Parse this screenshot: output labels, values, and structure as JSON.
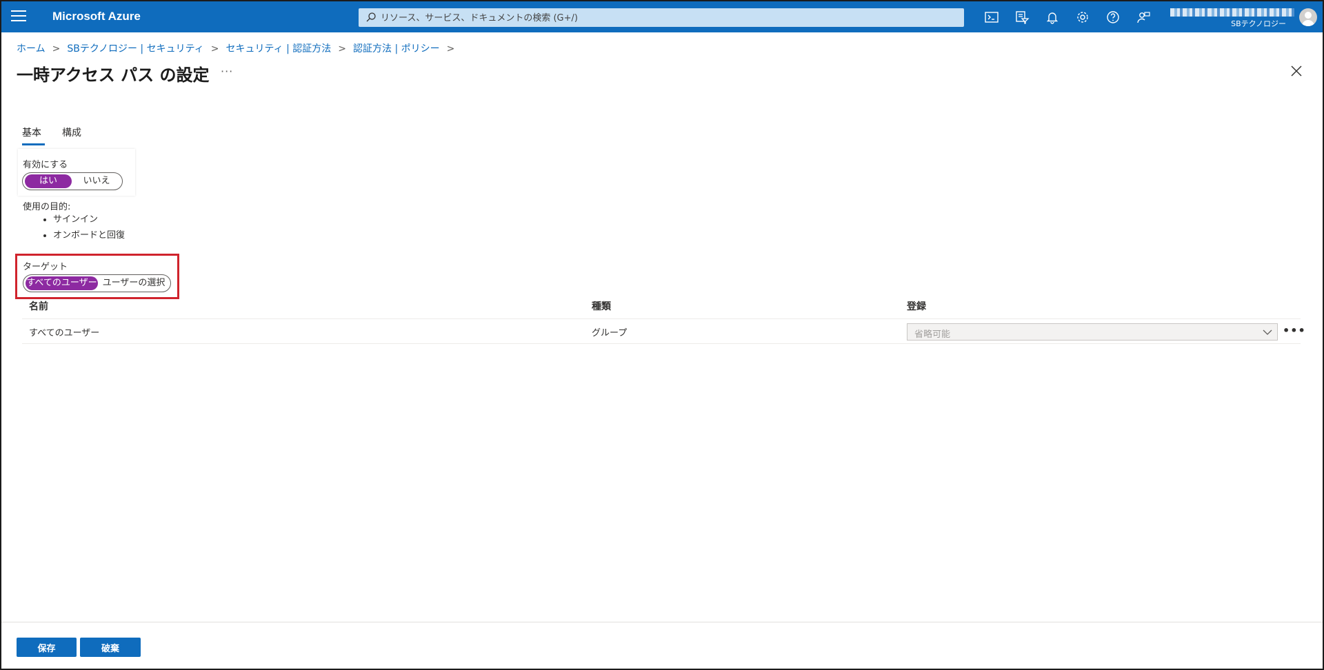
{
  "header": {
    "app_title": "Microsoft Azure",
    "search_placeholder": "リソース、サービス、ドキュメントの検索 (G+/)",
    "directory": "SBテクノロジー",
    "icons": [
      "cloud-shell-icon",
      "directory-filter-icon",
      "notifications-icon",
      "settings-icon",
      "help-icon",
      "feedback-icon"
    ]
  },
  "breadcrumb": [
    "ホーム",
    "SBテクノロジー | セキュリティ",
    "セキュリティ | 認証方法",
    "認証方法 | ポリシー"
  ],
  "page": {
    "title": "一時アクセス パス の設定",
    "more": "···"
  },
  "tabs": [
    {
      "label": "基本",
      "active": true
    },
    {
      "label": "構成",
      "active": false
    }
  ],
  "enable": {
    "label": "有効にする",
    "options": [
      "はい",
      "いいえ"
    ],
    "selected": "はい"
  },
  "purpose": {
    "label": "使用の目的:",
    "items": [
      "サインイン",
      "オンボードと回復"
    ]
  },
  "target": {
    "label": "ターゲット",
    "options": [
      "すべてのユーザー",
      "ユーザーの選択"
    ],
    "selected": "すべてのユーザー"
  },
  "table": {
    "columns": [
      "名前",
      "種類",
      "登録"
    ],
    "rows": [
      {
        "name": "すべてのユーザー",
        "type": "グループ",
        "registration": "省略可能"
      }
    ]
  },
  "footer": {
    "save": "保存",
    "discard": "破棄"
  },
  "colors": {
    "accent": "#0f6cbd",
    "toggle_on": "#8d2aa1",
    "highlight": "#d0232c"
  }
}
